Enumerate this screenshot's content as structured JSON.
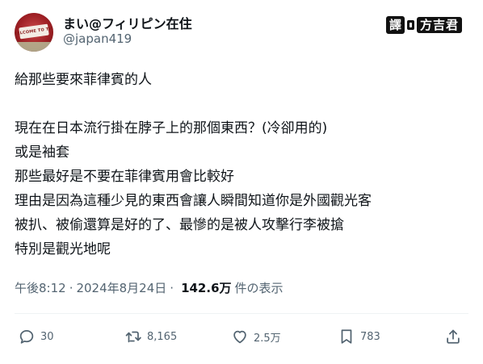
{
  "author": {
    "display_name": "まい@フィリピン在住",
    "handle": "@japan419",
    "avatar_sign_text": "WELCOME TO THE"
  },
  "watermark": {
    "chars": [
      "譯"
    ],
    "name": "方吉君"
  },
  "tweet": {
    "lines": [
      "給那些要來菲律賓的人",
      "",
      "現在在日本流行掛在脖子上的那個東西？(冷卻用的)",
      "或是袖套",
      "那些最好是不要在菲律賓用會比較好",
      "理由是因為這種少見的東西會讓人瞬間知道你是外國觀光客",
      "被扒、被偷還算是好的了、最慘的是被人攻擊行李被搶",
      "特別是觀光地呢"
    ]
  },
  "meta": {
    "time": "午後8:12",
    "separator": "·",
    "date": "2024年8月24日",
    "views_count": "142.6万",
    "views_label": "件の表示"
  },
  "actions": {
    "reply_count": "30",
    "retweet_count": "8,165",
    "like_count": "2.5万",
    "bookmark_count": "783",
    "icons": [
      "reply-icon",
      "retweet-icon",
      "like-icon",
      "bookmark-icon",
      "share-icon"
    ]
  },
  "colors": {
    "text_primary": "#0f1419",
    "text_secondary": "#536471",
    "divider": "#eff3f4",
    "avatar_red": "#9e1f24"
  }
}
